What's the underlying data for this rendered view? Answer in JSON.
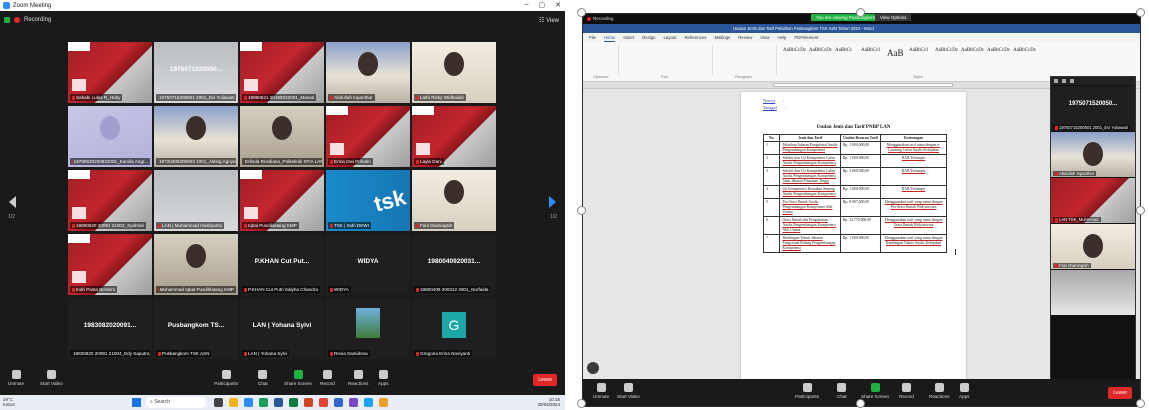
{
  "left_window": {
    "title": "Zoom Meeting",
    "recording": "Recording",
    "view": "View",
    "page_indicator_left": "1/2",
    "page_indicator_right": "1/2",
    "tiles": [
      {
        "name": "Sahabi Lubis R_Hoby",
        "style": "red"
      },
      {
        "name": "19750715200501 2001_Evi Yuliawati",
        "style": "gray",
        "big": "1975071520050..."
      },
      {
        "name": "19890521 20190032001_Mariati",
        "style": "red"
      },
      {
        "name": "Abdullah Inpanthar",
        "style": "photo"
      },
      {
        "name": "Lathi Rizky Widhalaiti",
        "style": "wall"
      },
      {
        "name": "19780520200922001_Kamila Angr...",
        "style": "blur"
      },
      {
        "name": "19720405200503 1001_Akting Agriyat...",
        "style": "photo"
      },
      {
        "name": "Erlinda Rosdiana_Politeknik STIA LAN J...",
        "style": "office"
      },
      {
        "name": "Erma Dwi Prihatin",
        "style": "red"
      },
      {
        "name": "Layla Dani",
        "style": "red"
      },
      {
        "name": "19890520 20091 21003_Syahrial",
        "style": "red"
      },
      {
        "name": "LAN | Muhammad Husbyanto",
        "style": "gray"
      },
      {
        "name": "Iqbal Pusdiklatang KMP",
        "style": "red"
      },
      {
        "name": "TSK | Indri DEWI",
        "style": "tsk"
      },
      {
        "name": "Fani Dwiningsih",
        "style": "wall"
      },
      {
        "name": "Indri Pasta Bentoro",
        "style": "red"
      },
      {
        "name": "Muhammad Iqbal Pusdiklatang KMP",
        "style": "office"
      },
      {
        "name": "P.KHAN Cut Putri Salyha Chandra",
        "style": "dark",
        "big": "P.KHAN Cut Put..."
      },
      {
        "name": "WIDYA",
        "style": "dark",
        "big": "WIDYA"
      },
      {
        "name": "19800409 200312 2001_Nurfaida",
        "style": "dark",
        "big": "1980040920031..."
      },
      {
        "name": "19830820 20091 21004_Edy Saputra_...",
        "style": "dark",
        "big": "1983082020091..."
      },
      {
        "name": "Pusbangkom TSK ASN",
        "style": "dark",
        "big": "Pusbangkom TS..."
      },
      {
        "name": "LAN | Yohana Sylvi",
        "style": "dark",
        "big": "LAN | Yohana Sylvi"
      },
      {
        "name": "Revia Samidona",
        "style": "bird"
      },
      {
        "name": "Gregoria Erina Noviyanti",
        "style": "g",
        "letter": "G"
      }
    ],
    "toolbar": {
      "unmute": "Unmute",
      "start_video": "Start Video",
      "participants": "Participants",
      "participants_count": "14",
      "chat": "Chat",
      "share_screen": "Share Screen",
      "record": "Record",
      "reactions": "Reactions",
      "apps": "Apps",
      "leave": "Leave"
    },
    "taskbar": {
      "weather_temp": "29°C",
      "weather_desc": "Kabut",
      "search": "Search",
      "time": "10:15",
      "date": "30/04/2024"
    }
  },
  "right_window": {
    "recording": "Recording",
    "share_banner": "You are viewing Pusbangkom's screen",
    "view_options": "View Options",
    "word_title": "Usulan Jenis dan Tarif Pelatihan Pusbangkom TSK ASN Tahun 2024 - Word",
    "menu": [
      "File",
      "Home",
      "Insert",
      "Design",
      "Layout",
      "References",
      "Mailings",
      "Review",
      "View",
      "Help",
      "PDFelement"
    ],
    "ribbon_styles": [
      "AaBbCcDc",
      "AaBbCcDc",
      "AaBbCc",
      "AaBbCcI",
      "AaB",
      "AaBbCcI",
      "AaBbCcDc",
      "AaBbCcDc",
      "AaBbCcDc",
      "AaBbCcDc"
    ],
    "ribbon_groups": [
      "Clipboard",
      "Font",
      "Paragraph",
      "Styles"
    ],
    "memo": [
      {
        "label": "Nomor",
        "value": ":"
      },
      {
        "label": "Tanggal",
        "value": ":"
      }
    ],
    "doc_title": "Usulan Jenis dan Tarif PNBP LAN",
    "table": {
      "headers": [
        "No.",
        "Jenis dan Tarif",
        "Usulan Besaran Tarif",
        "Keterangan"
      ],
      "rows": [
        [
          "1.",
          "Pelatihan Jabatan Fungsional Analis Pengembangan Kompetensi",
          "Rp. 1.000.000,00",
          "Menggunakan tarif sama dengan e-Learning Calon Analis Kebijakan"
        ],
        [
          "2.",
          "Seleksi dan Uji Kompetensi Calon Analis Pengembangan Kompetensi",
          "Rp. 1.000.000,00",
          "RAB Terlampir"
        ],
        [
          "3.",
          "Seleksi dan Uji Kompetensi Calon Analis Pengembangan Kompetensi Jabat Jabatan Pimpinan Tinggi",
          "Rp. 3.000.000,00",
          "RAB Terlampir"
        ],
        [
          "4.",
          "Uji Kompetensi Kenaikan Jenjang Analis Pengembangan Kompetensi",
          "Rp. 1.000.000,00",
          "RAB Terlampir"
        ],
        [
          "5.",
          "Pra Orasi Ilmiah Analis Pengembangan Kompetensi Ahli Utama",
          "Rp. 8.007.000,00",
          "Menggunakan tarif yang sama dengan Pra Orasi Ilmiah Widyaiswara"
        ],
        [
          "6.",
          "Orasi Ilmiah dan Pengukuhan Analis Pengembangan Kompetensi Ahli Utama",
          "Rp. 12.770.000,00",
          "Menggunakan tarif yang sama dengan Orasi Ilmiah Widyaiswara"
        ],
        [
          "7.",
          "Bimbingan Teknis Jabatan Fungsional Bidang Pengembangan Kompetensi",
          "Rp. 1.000.000,00",
          "Menggunakan tarif yang sama dengan Bimbingan Teknis Analis Kebijakan"
        ]
      ]
    },
    "gallery": [
      {
        "name": "19750715200501 2001_Evi Yuliawati",
        "style": "dark",
        "big": "1975071520050..."
      },
      {
        "name": "Abdullah Inpanthar",
        "style": "photo"
      },
      {
        "name": "LAN TSK_Muhmmad",
        "style": "red"
      },
      {
        "name": "Fani Dwiningsih",
        "style": "wall"
      },
      {
        "name": "",
        "style": "gray"
      }
    ],
    "toolbar": {
      "unmute": "Unmute",
      "start_video": "Start Video",
      "participants": "Participants",
      "participants_count": "14",
      "chat": "Chat",
      "share_screen": "Share Screen",
      "record": "Record",
      "reactions": "Reactions",
      "apps": "Apps",
      "leave": "Leave"
    }
  },
  "colors": {
    "zoom_blue": "#2d8cff",
    "leave_red": "#e02828",
    "share_green": "#1fb141",
    "word_blue": "#2b579a"
  }
}
